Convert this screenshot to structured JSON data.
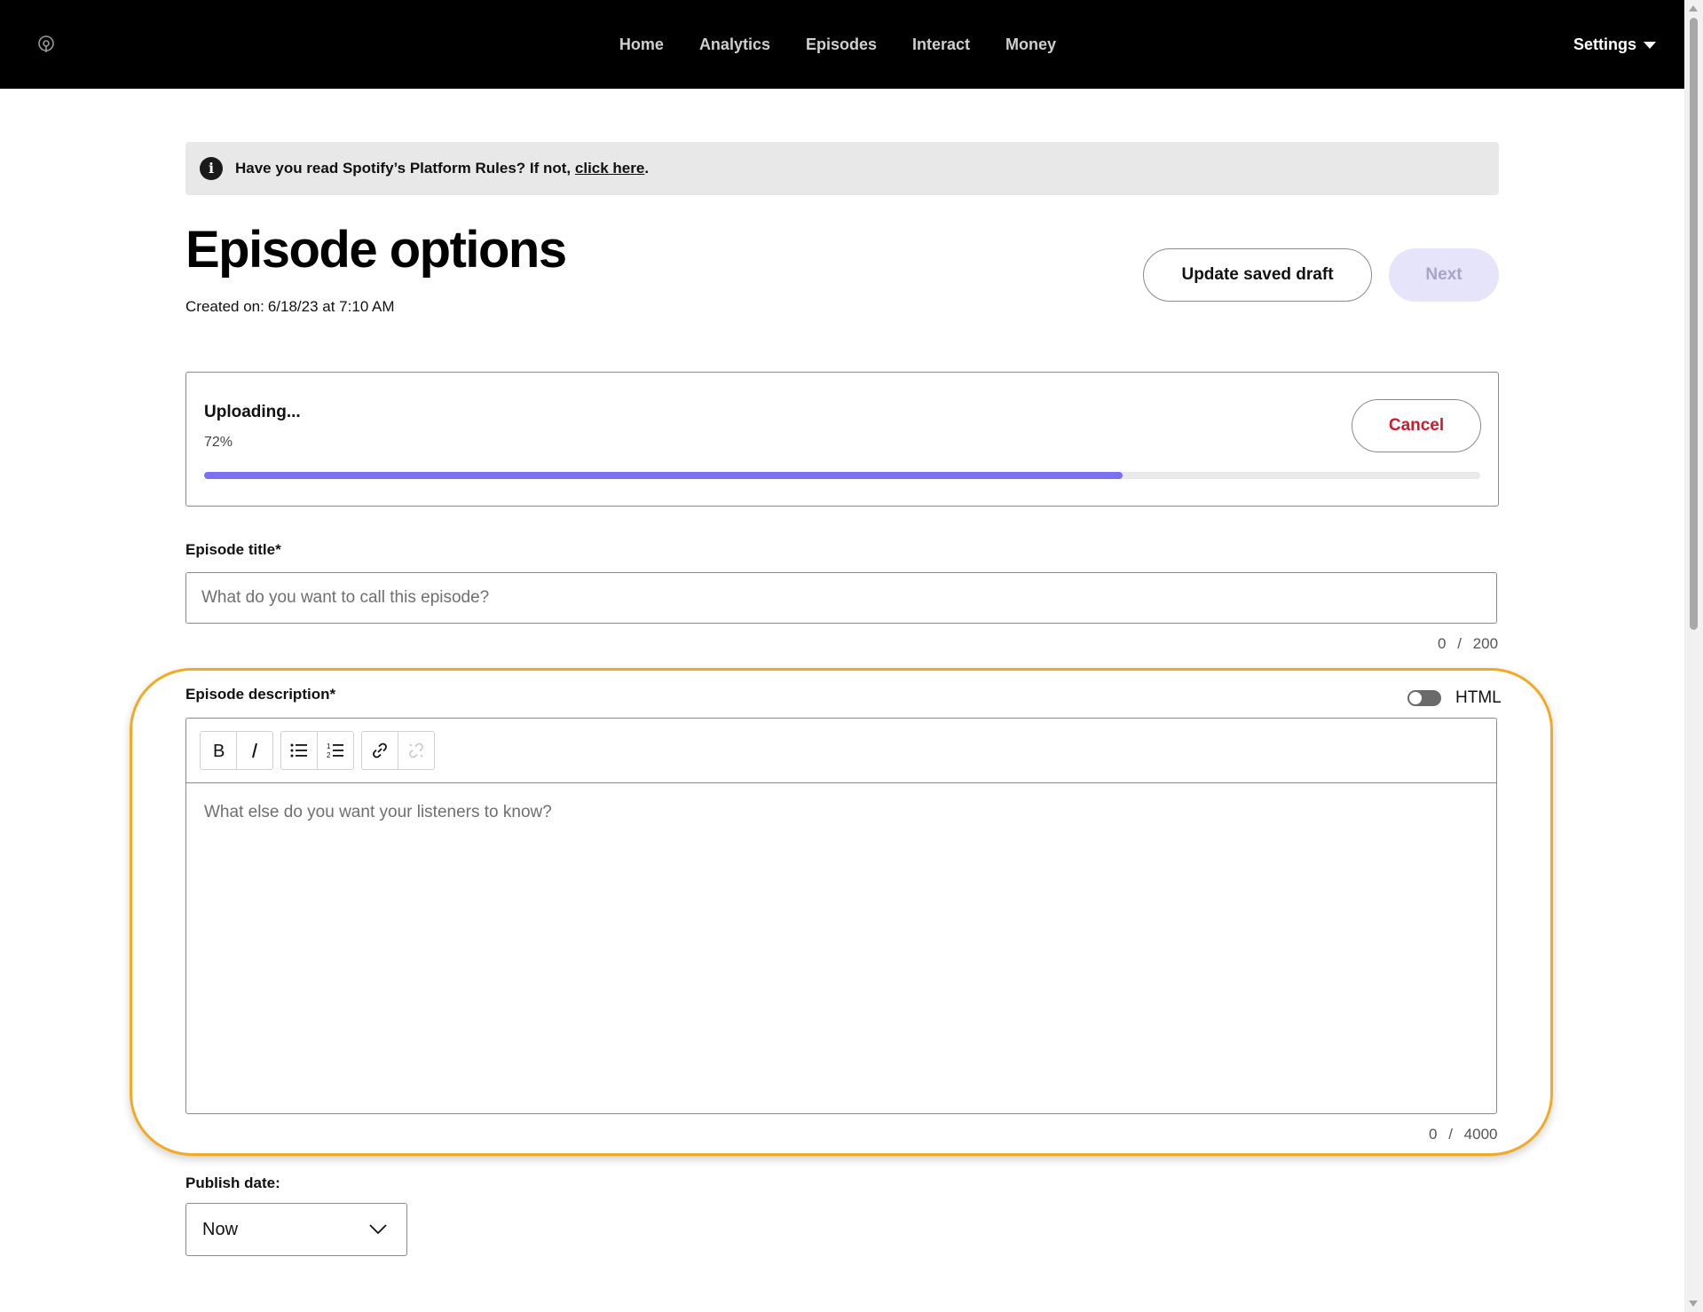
{
  "nav": {
    "logo_icon": "podcast-icon",
    "items": [
      "Home",
      "Analytics",
      "Episodes",
      "Interact",
      "Money"
    ],
    "settings_label": "Settings"
  },
  "banner": {
    "icon": "info-icon",
    "text": "Have you read Spotify’s Platform Rules? If not, ",
    "link_text": "click here",
    "suffix": "."
  },
  "header": {
    "title": "Episode options",
    "created_label": "Created on:",
    "created_value": "6/18/23 at 7:10 AM",
    "draft_button": "Update saved draft",
    "next_button": "Next"
  },
  "upload": {
    "title": "Uploading...",
    "percent_text": "72%",
    "progress": 0.72,
    "cancel_label": "Cancel",
    "accent_color": "#7b6ff2",
    "cancel_color": "#cc1b2a"
  },
  "episode_title": {
    "label": "Episode title*",
    "placeholder": "What do you want to call this episode?",
    "count": "0",
    "separator": "/",
    "max": "200"
  },
  "episode_description": {
    "label": "Episode description*",
    "html_toggle_label": "HTML",
    "html_toggle_on": false,
    "toolbar": [
      "bold-icon",
      "italic-icon",
      "bullet-list-icon",
      "numbered-list-icon",
      "link-icon",
      "unlink-icon"
    ],
    "placeholder": "What else do you want your listeners to know?",
    "count": "0",
    "separator": "/",
    "max": "4000",
    "highlight_color": "#f0aa25"
  },
  "publish_date": {
    "label": "Publish date:",
    "selected": "Now"
  }
}
